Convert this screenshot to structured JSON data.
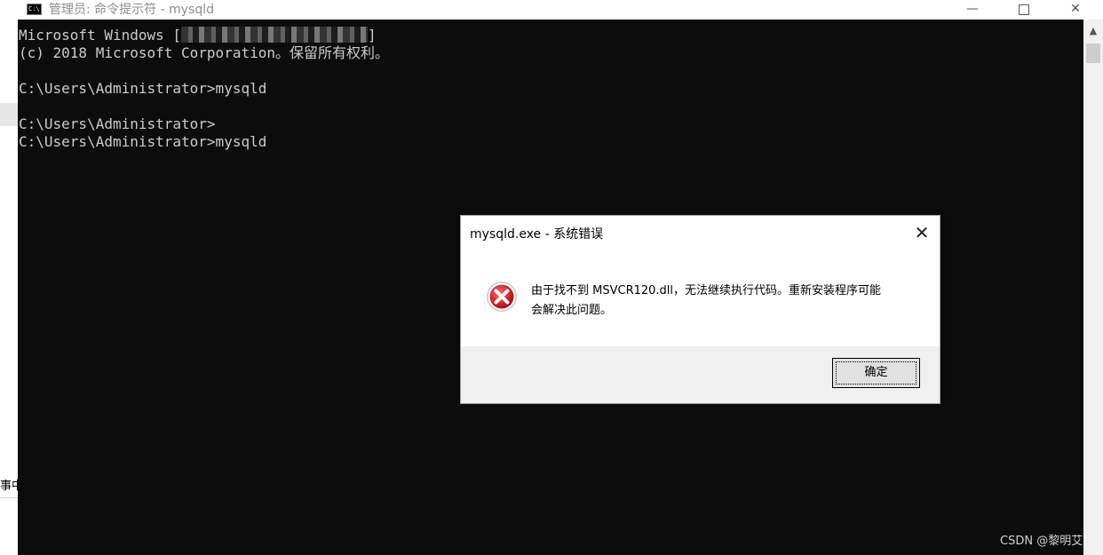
{
  "window": {
    "title": "管理员: 命令提示符 - mysqld",
    "icon_text": "C:\\",
    "minimize_glyph": "—",
    "close_glyph": "✕"
  },
  "console": {
    "lines": [
      "Microsoft Windows ",
      "(c) 2018 Microsoft Corporation。保留所有权利。",
      "",
      "C:\\Users\\Administrator>mysqld",
      "",
      "C:\\Users\\Administrator>",
      "C:\\Users\\Administrator>mysqld"
    ],
    "redacted_suffix_open": "[",
    "redacted_suffix_close": "]"
  },
  "left_partial_text": "事中",
  "scrollbar": {
    "up_glyph": "▲"
  },
  "dialog": {
    "title": "mysqld.exe - 系统错误",
    "close_glyph": "✕",
    "message_line1": "由于找不到 MSVCR120.dll，无法继续执行代码。重新安装程序可能",
    "message_line2": "会解决此问题。",
    "ok_label": "确定",
    "icon": "error-icon",
    "colors": {
      "error_red": "#d4202c",
      "footer_bg": "#f0f0f0"
    }
  },
  "watermark": "CSDN @黎明艾"
}
